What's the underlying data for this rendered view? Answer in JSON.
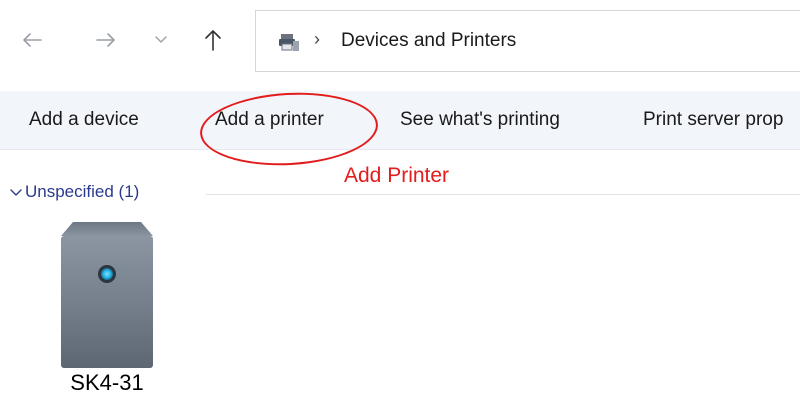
{
  "navigation": {
    "back_icon": "arrow-left-icon",
    "forward_icon": "arrow-right-icon",
    "recent_icon": "chevron-down-icon",
    "up_icon": "arrow-up-icon"
  },
  "address_bar": {
    "location_icon": "devices-printers-icon",
    "separator": "›",
    "path": "Devices and Printers"
  },
  "command_bar": {
    "add_device": "Add a device",
    "add_printer": "Add a printer",
    "see_printing": "See what's printing",
    "print_server_props": "Print server prop"
  },
  "annotation": {
    "label": "Add Printer",
    "color": "#e21c1c"
  },
  "group": {
    "label": "Unspecified (1)"
  },
  "devices": [
    {
      "name": "SK4-31",
      "icon": "computer-tower-icon"
    }
  ],
  "colors": {
    "command_bar_bg": "#f2f5fa",
    "group_label": "#2b3a8c",
    "device_status_light": "#29b6e8"
  }
}
